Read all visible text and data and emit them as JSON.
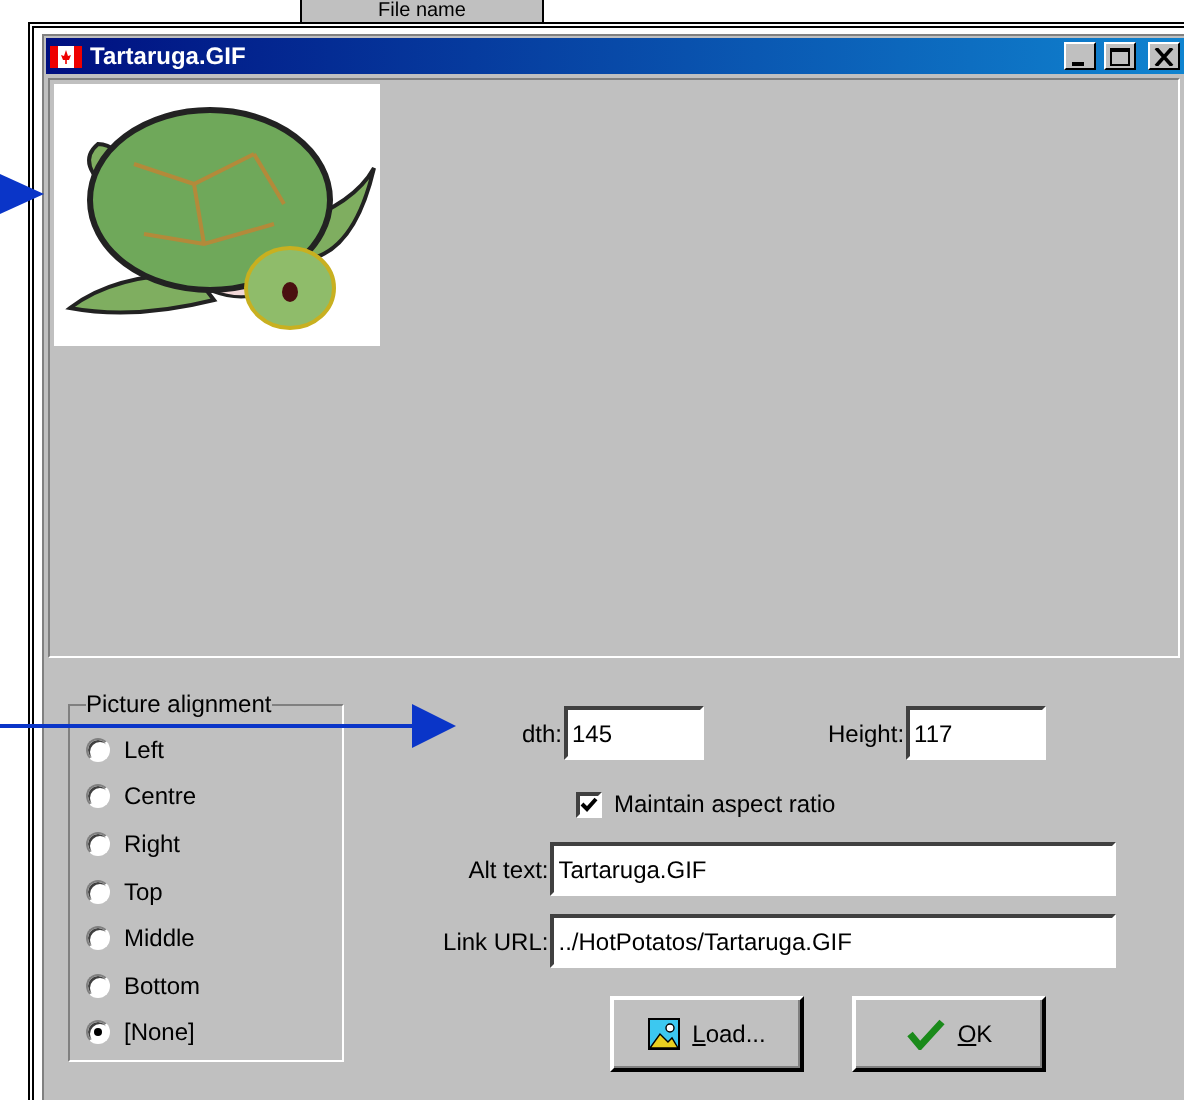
{
  "background": {
    "tab_label": "File name"
  },
  "window": {
    "title": "Tartaruga.GIF",
    "controls": [
      {
        "kind": "minimize"
      },
      {
        "kind": "maximize"
      },
      {
        "kind": "close"
      }
    ]
  },
  "alignment": {
    "title": "Picture alignment",
    "options": [
      {
        "label": "Left",
        "selected": false
      },
      {
        "label": "Centre",
        "selected": false
      },
      {
        "label": "Right",
        "selected": false
      },
      {
        "label": "Top",
        "selected": false
      },
      {
        "label": "Middle",
        "selected": false
      },
      {
        "label": "Bottom",
        "selected": false
      },
      {
        "label": "[None]",
        "selected": true
      }
    ]
  },
  "width": {
    "label": "dth:",
    "value": "145"
  },
  "height": {
    "label": "Height:",
    "value": "117"
  },
  "maintain_aspect": {
    "label": "Maintain aspect ratio",
    "checked": true
  },
  "alt_text": {
    "label": "Alt text:",
    "value": "Tartaruga.GIF"
  },
  "link_url": {
    "label": "Link URL:",
    "value": "../HotPotatos/Tartaruga.GIF"
  },
  "buttons": [
    {
      "kind": "load",
      "label": "Load..."
    },
    {
      "kind": "ok",
      "label": "OK"
    }
  ]
}
